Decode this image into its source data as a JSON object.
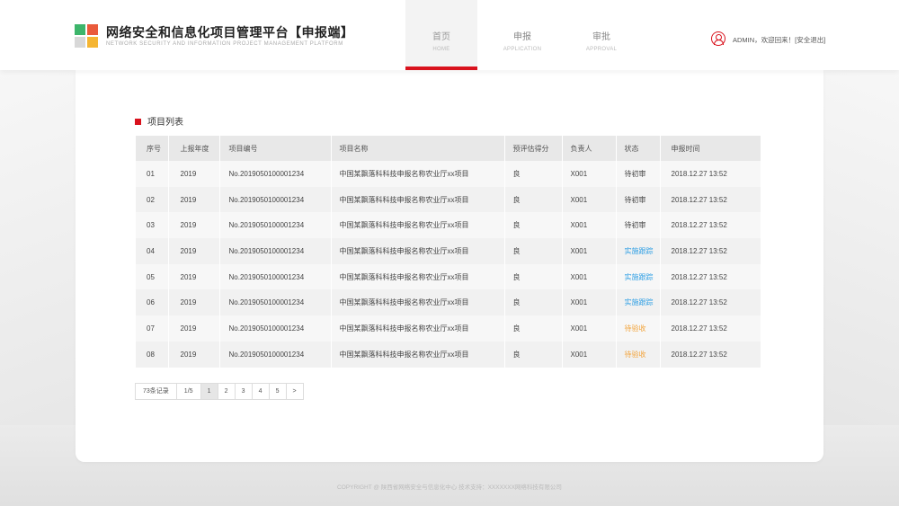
{
  "header": {
    "title": "网络安全和信息化项目管理平台【申报端】",
    "subtitle": "NETWORK SECURITY AND INFORMATION PROJECT MANAGEMENT PLATFORM",
    "nav": [
      {
        "cn": "首页",
        "en": "HOME"
      },
      {
        "cn": "申报",
        "en": "APPLICATION"
      },
      {
        "cn": "审批",
        "en": "APPROVAL"
      }
    ],
    "user_greeting": "ADMIN，欢迎回来！",
    "logout": "[安全退出]"
  },
  "section": {
    "title": "项目列表"
  },
  "table": {
    "headers": [
      "序号",
      "上报年度",
      "项目编号",
      "项目名称",
      "预评估得分",
      "负责人",
      "状态",
      "申报时间"
    ],
    "rows": [
      [
        "01",
        "2019",
        "No.2019050100001234",
        "中国某飘落科科技申报名称农业厅xx项目",
        "良",
        "X001",
        "待初审",
        "2018.12.27 13:52"
      ],
      [
        "02",
        "2019",
        "No.2019050100001234",
        "中国某飘落科科技申报名称农业厅xx项目",
        "良",
        "X001",
        "待初审",
        "2018.12.27 13:52"
      ],
      [
        "03",
        "2019",
        "No.2019050100001234",
        "中国某飘落科科技申报名称农业厅xx项目",
        "良",
        "X001",
        "待初审",
        "2018.12.27 13:52"
      ],
      [
        "04",
        "2019",
        "No.2019050100001234",
        "中国某飘落科科技申报名称农业厅xx项目",
        "良",
        "X001",
        "实施跟踪",
        "2018.12.27 13:52"
      ],
      [
        "05",
        "2019",
        "No.2019050100001234",
        "中国某飘落科科技申报名称农业厅xx项目",
        "良",
        "X001",
        "实施跟踪",
        "2018.12.27 13:52"
      ],
      [
        "06",
        "2019",
        "No.2019050100001234",
        "中国某飘落科科技申报名称农业厅xx项目",
        "良",
        "X001",
        "实施跟踪",
        "2018.12.27 13:52"
      ],
      [
        "07",
        "2019",
        "No.2019050100001234",
        "中国某飘落科科技申报名称农业厅xx项目",
        "良",
        "X001",
        "待验收",
        "2018.12.27 13:52"
      ],
      [
        "08",
        "2019",
        "No.2019050100001234",
        "中国某飘落科科技申报名称农业厅xx项目",
        "良",
        "X001",
        "待验收",
        "2018.12.27 13:52"
      ]
    ],
    "status_colors": {
      "实施跟踪": "#2f9fe4",
      "待验收": "#f2a33a",
      "待初审": "#444444"
    }
  },
  "pagination": {
    "total": "73条记录",
    "page_of": "1/5",
    "pages": [
      "1",
      "2",
      "3",
      "4",
      "5"
    ],
    "next": ">"
  },
  "footer": {
    "text": "COPYRIGHT @ 陕西省网络安全与信息化中心  技术支持：XXXXXXX网络科技有限公司"
  },
  "colors": {
    "accent": "#d9121d",
    "logo": [
      "#3db56b",
      "#ea5a3b",
      "#d8d8d8",
      "#f5b532"
    ]
  }
}
